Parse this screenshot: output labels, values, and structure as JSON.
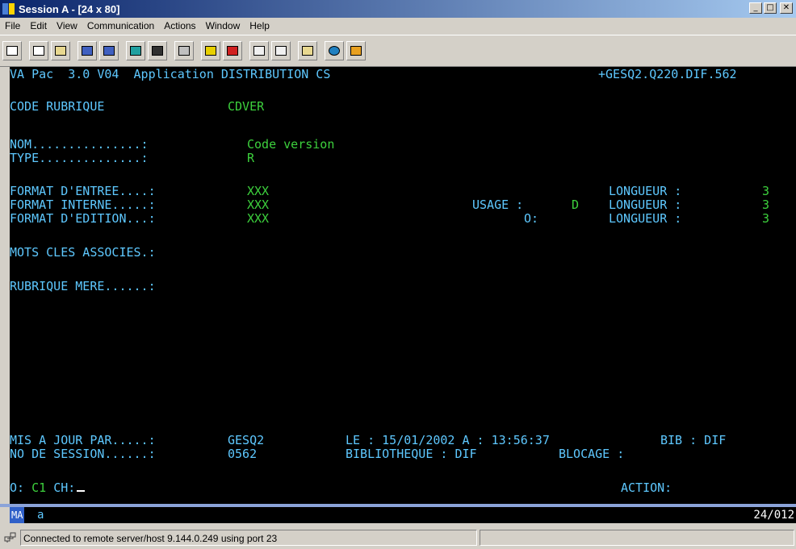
{
  "window": {
    "title": "Session A - [24 x 80]"
  },
  "menu": [
    "File",
    "Edit",
    "View",
    "Communication",
    "Actions",
    "Window",
    "Help"
  ],
  "toolbar": [
    "print-screen-icon",
    "copy-icon",
    "paste-icon",
    "send-icon",
    "receive-icon",
    "display-setup-icon",
    "color-icon",
    "keyboard-map-icon",
    "macro-record-icon",
    "macro-stop-icon",
    "macro-play-icon",
    "macro-play2-icon",
    "clipboard-icon",
    "globe-icon",
    "pencil-icon"
  ],
  "screen": {
    "header_left": "VA Pac  3.0 V04  Application DISTRIBUTION CS",
    "header_right": "+GESQ2.Q220.DIF.562",
    "code_rubrique_label": "CODE RUBRIQUE",
    "code_rubrique_value": "CDVER",
    "nom_label": "NOM...............:",
    "nom_value": "Code version",
    "type_label": "TYPE..............:",
    "type_value": "R",
    "format_entree_label": "FORMAT D'ENTREE....:",
    "format_entree_value": "XXX",
    "format_interne_label": "FORMAT INTERNE.....:",
    "format_interne_value": "XXX",
    "format_edition_label": "FORMAT D'EDITION...:",
    "format_edition_value": "XXX",
    "usage_label": "USAGE :",
    "usage_value": "D",
    "o_label": "O:",
    "longueur_label": "LONGUEUR :",
    "longueur_1": "3",
    "longueur_2": "3",
    "longueur_3": "3",
    "mots_cles_label": "MOTS CLES ASSOCIES.:",
    "rubrique_mere_label": "RUBRIQUE MERE......:",
    "mis_a_jour_label": "MIS A JOUR PAR.....:",
    "mis_a_jour_value": "GESQ2",
    "le_text": "LE : 15/01/2002 A : 13:56:37",
    "bib_text": "BIB : DIF",
    "no_session_label": "NO DE SESSION......:",
    "no_session_value": "0562",
    "bibliotheque_text": "BIBLIOTHEQUE : DIF",
    "blocage_text": "BLOCAGE :",
    "cmd_o": "O:",
    "cmd_c1": "C1",
    "cmd_ch": "CH:",
    "action_label": "ACTION:"
  },
  "oia": {
    "mode": "MA",
    "indicator": "a",
    "cursor_pos": "24/012"
  },
  "status": {
    "message": "Connected to remote server/host 9.144.0.249 using port 23"
  }
}
